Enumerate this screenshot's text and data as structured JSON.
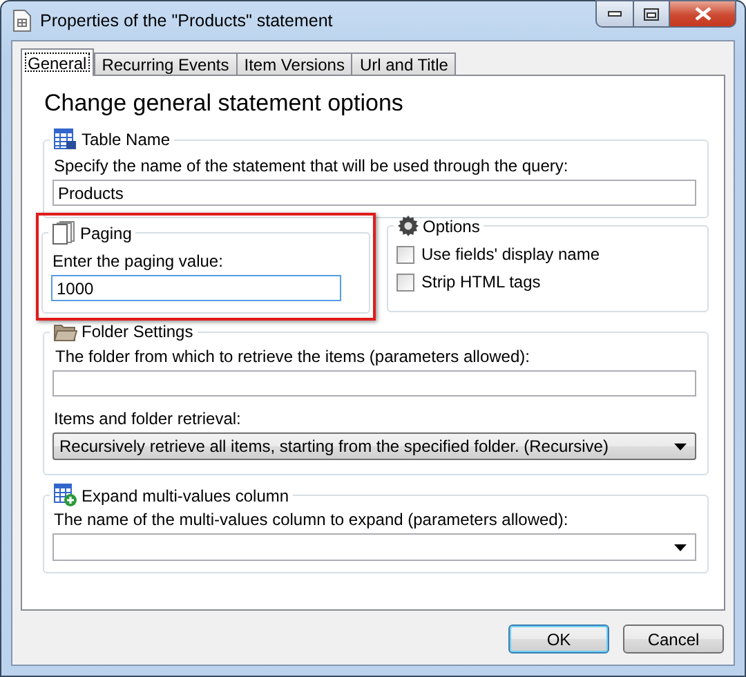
{
  "window": {
    "title": "Properties of the \"Products\" statement"
  },
  "tabs": [
    {
      "label": "General",
      "selected": true
    },
    {
      "label": "Recurring Events",
      "selected": false
    },
    {
      "label": "Item Versions",
      "selected": false
    },
    {
      "label": "Url and Title",
      "selected": false
    }
  ],
  "heading": "Change general statement options",
  "table_name": {
    "title": "Table Name",
    "label": "Specify the name of the statement that will be used through the query:",
    "value": "Products"
  },
  "paging": {
    "title": "Paging",
    "highlighted": true,
    "label": "Enter the paging value:",
    "value": "1000"
  },
  "options": {
    "title": "Options",
    "checkboxes": [
      {
        "label": "Use fields' display name",
        "checked": false
      },
      {
        "label": "Strip HTML tags",
        "checked": false
      }
    ]
  },
  "folder_settings": {
    "title": "Folder Settings",
    "folder_label": "The folder from which to retrieve the items (parameters allowed):",
    "retrieval_label": "Items and folder retrieval:",
    "retrieval_value": "Recursively retrieve all items, starting from the specified folder. (Recursive)"
  },
  "expand": {
    "title": "Expand multi-values column",
    "label": "The name of the multi-values column to expand (parameters allowed):"
  },
  "buttons": [
    {
      "label": "OK",
      "default": true
    },
    {
      "label": "Cancel",
      "default": false
    }
  ]
}
